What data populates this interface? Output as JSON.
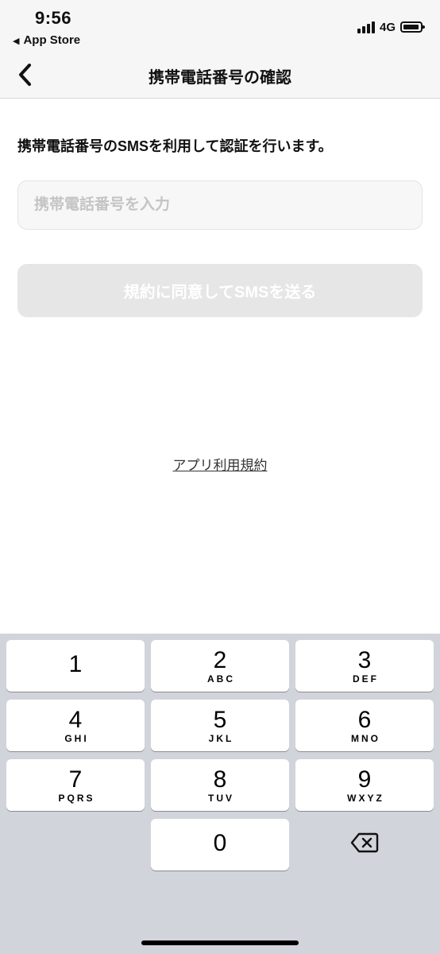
{
  "status_bar": {
    "time": "9:56",
    "back_app_label": "App Store",
    "network": "4G"
  },
  "nav": {
    "title": "携帯電話番号の確認",
    "back_icon": "chevron-left-icon"
  },
  "main": {
    "description": "携帯電話番号のSMSを利用して認証を行います。",
    "phone_input": {
      "placeholder": "携帯電話番号を入力",
      "value": ""
    },
    "send_button_label": "規約に同意してSMSを送る",
    "terms_link_label": "アプリ利用規約"
  },
  "keypad": {
    "keys": [
      {
        "digit": "1",
        "letters": ""
      },
      {
        "digit": "2",
        "letters": "ABC"
      },
      {
        "digit": "3",
        "letters": "DEF"
      },
      {
        "digit": "4",
        "letters": "GHI"
      },
      {
        "digit": "5",
        "letters": "JKL"
      },
      {
        "digit": "6",
        "letters": "MNO"
      },
      {
        "digit": "7",
        "letters": "PQRS"
      },
      {
        "digit": "8",
        "letters": "TUV"
      },
      {
        "digit": "9",
        "letters": "WXYZ"
      },
      {
        "digit": "0",
        "letters": ""
      }
    ],
    "delete_icon": "backspace-icon"
  },
  "colors": {
    "nav_background": "#f6f6f6",
    "button_disabled": "#e6e6e6",
    "keypad_background": "#d1d4da"
  }
}
